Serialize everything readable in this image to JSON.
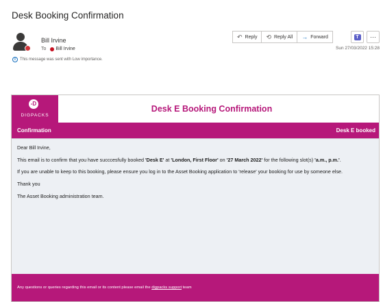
{
  "header": {
    "subject": "Desk Booking Confirmation",
    "sender": "Bill Irvine",
    "to_label": "To",
    "recipient": "Bill Irvine",
    "importance": "This message was sent with Low importance.",
    "date": "Sun 27/03/2022 15:28",
    "actions": {
      "reply": "Reply",
      "reply_all": "Reply All",
      "forward": "Forward",
      "more": "···"
    }
  },
  "icons": {
    "reply": "reply-icon",
    "reply_all": "reply-all-icon",
    "forward": "forward-icon",
    "teams": "teams-icon",
    "info": "info-icon"
  },
  "colors": {
    "brand": "#b6187a",
    "content_bg": "#edf0f4",
    "presence_busy": "#d13438"
  },
  "email": {
    "logo_text": "DIGPACKS",
    "banner_title": "Desk E Booking Confirmation",
    "bar_left": "Confirmation",
    "bar_right": "Desk E booked",
    "greeting": "Dear Bill Irvine,",
    "para1": {
      "t1": "This email is to confirm that you have succcesfully booked ",
      "desk": "'Desk E'",
      "t2": " at ",
      "location": "'London, First Floor'",
      "t3": " on ",
      "date": "'27 March 2022'",
      "t4": " for the following slot(s) ",
      "slots": "'a.m., p.m.'",
      "t5": "."
    },
    "para2": "If you are unable to keep to this booking, please ensure you log in to the Asset Booking application to 'release' your booking for use by someone else.",
    "thanks": "Thank you",
    "signoff": "The Asset Booking administration team.",
    "footer": {
      "text": "Any questions or queries regarding this email or its content please email the ",
      "link": "digpacks support",
      "text_end": " team"
    }
  }
}
